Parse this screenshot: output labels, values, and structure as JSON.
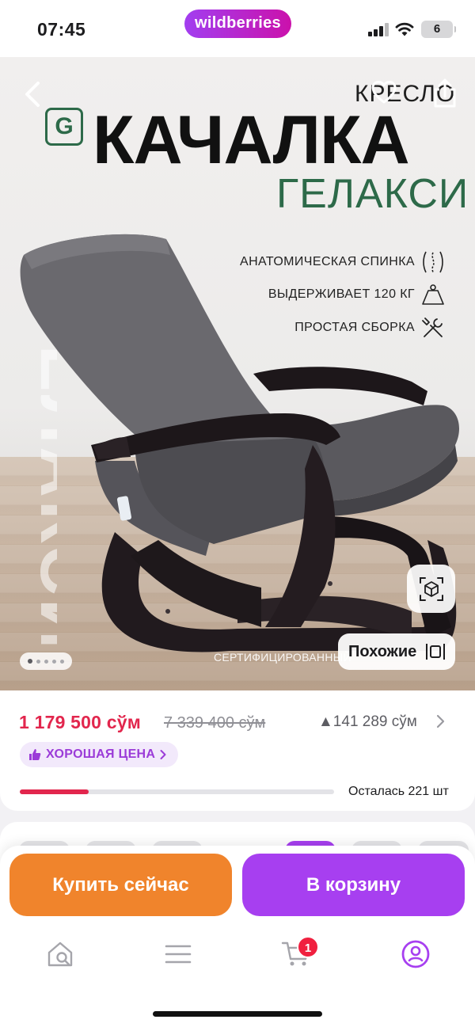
{
  "status_bar": {
    "time": "07:45",
    "app_badge": "wildberries",
    "battery": "6"
  },
  "hero": {
    "title_small": "КРЕСЛО",
    "title_main": "КАЧАЛКА",
    "title_sub": "ГЕЛАКСИ",
    "brand_letter": "G",
    "features": [
      {
        "label": "АНАТОМИЧЕСКАЯ СПИНКА",
        "icon": "spine-icon"
      },
      {
        "label": "ВЫДЕРЖИВАЕТ 120 КГ",
        "icon": "weight-icon"
      },
      {
        "label": "ПРОСТАЯ СБОРКА",
        "icon": "tools-icon"
      }
    ],
    "certified_text": "СЕРТИФИЦИРОВАННЫЙ",
    "similar_label": "Похожие",
    "gallery_total": 5,
    "gallery_active": 1
  },
  "price": {
    "current": "1 179 500 сўм",
    "old": "7 339 400 сўм",
    "delta": "▲141 289 сўм",
    "badge": "ХОРОШАЯ ЦЕНА",
    "stock_text": "Осталась 221 шт",
    "stock_fraction": 0.22
  },
  "actions": {
    "buy_now": "Купить сейчас",
    "add_to_cart": "В корзину"
  },
  "tab_bar": {
    "cart_count": "1"
  },
  "colors": {
    "brand_purple": "#a73ff0",
    "buy_orange": "#f0842c",
    "price_red": "#e2264d",
    "badge_bg": "#f2e9fb",
    "galaxy_green": "#2d6a49"
  }
}
